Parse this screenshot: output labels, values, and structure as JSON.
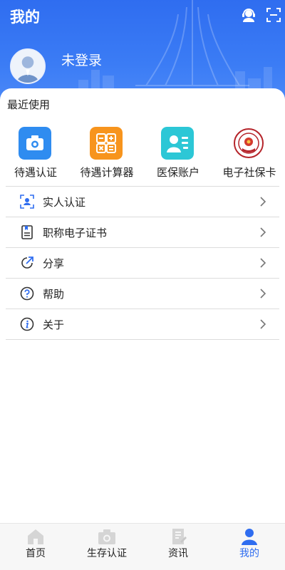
{
  "header": {
    "title": "我的",
    "login_status": "未登录",
    "icons": {
      "service": "customer-service-icon",
      "scan": "scan-icon"
    }
  },
  "recent": {
    "title": "最近使用",
    "items": [
      {
        "label": "待遇认证",
        "icon": "camera-icon",
        "color": "#2f8cf0"
      },
      {
        "label": "待遇计算器",
        "icon": "calculator-icon",
        "color": "#f7941d"
      },
      {
        "label": "医保账户",
        "icon": "id-card-icon",
        "color": "#2cc7d6"
      },
      {
        "label": "电子社保卡",
        "icon": "social-security-emblem-icon",
        "color": "#b5242a"
      }
    ]
  },
  "menu": {
    "items": [
      {
        "label": "实人认证",
        "icon": "face-scan-icon"
      },
      {
        "label": "职称电子证书",
        "icon": "certificate-icon"
      },
      {
        "label": "分享",
        "icon": "share-icon"
      },
      {
        "label": "帮助",
        "icon": "help-icon"
      },
      {
        "label": "关于",
        "icon": "info-icon"
      }
    ]
  },
  "tabbar": {
    "items": [
      {
        "label": "首页",
        "icon": "home-icon",
        "active": false
      },
      {
        "label": "生存认证",
        "icon": "camera-icon",
        "active": false
      },
      {
        "label": "资讯",
        "icon": "news-icon",
        "active": false
      },
      {
        "label": "我的",
        "icon": "user-icon",
        "active": true
      }
    ],
    "active_color": "#2f6df0"
  }
}
